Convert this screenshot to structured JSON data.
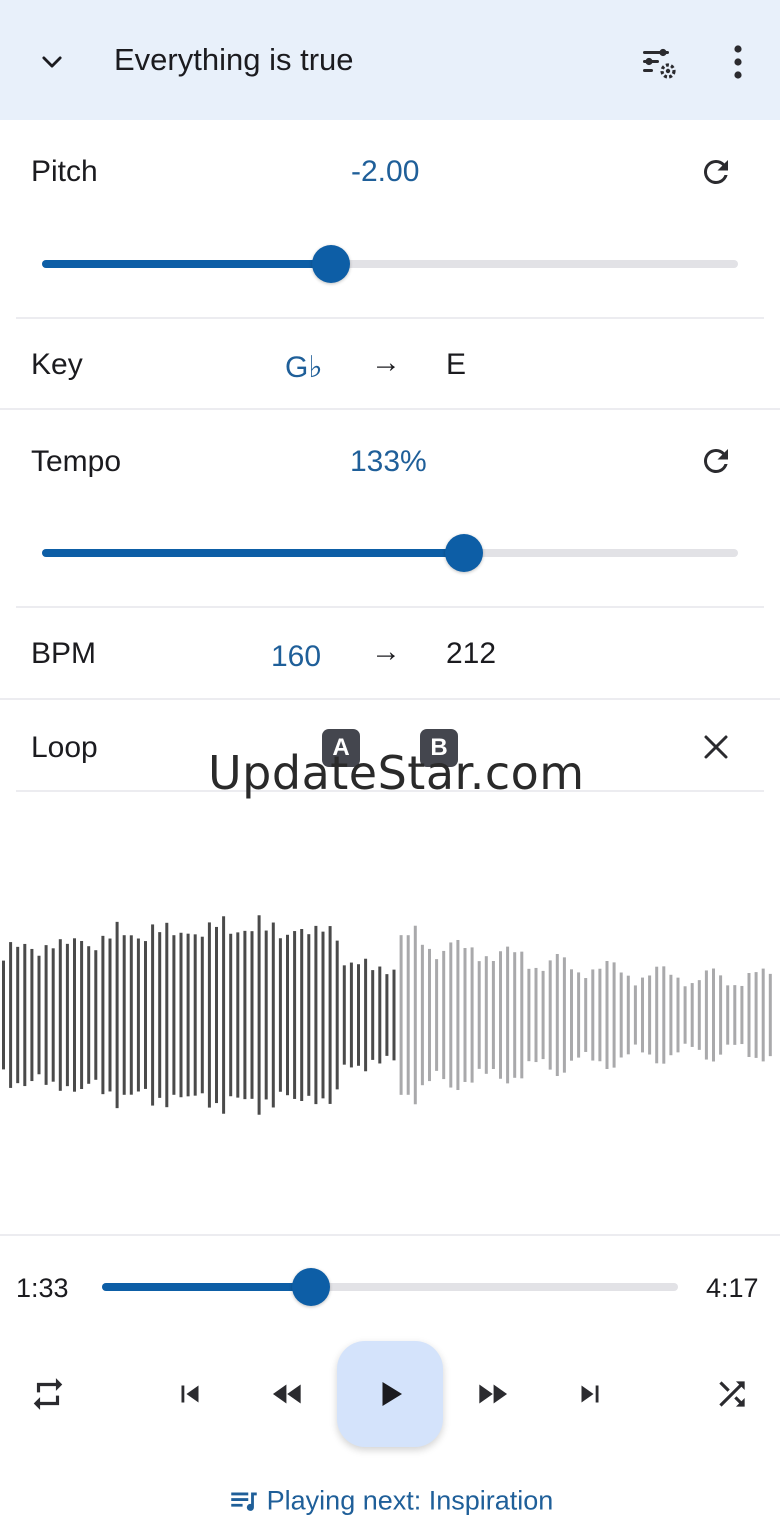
{
  "header": {
    "title": "Everything is true"
  },
  "pitch": {
    "label": "Pitch",
    "value": "-2.00",
    "slider_fraction": 0.415
  },
  "key": {
    "label": "Key",
    "from": "G♭",
    "arrow": "→",
    "to": "E"
  },
  "tempo": {
    "label": "Tempo",
    "value": "133%",
    "slider_fraction": 0.607
  },
  "bpm": {
    "label": "BPM",
    "from": "160",
    "arrow": "→",
    "to": "212"
  },
  "loop": {
    "label": "Loop",
    "a_label": "A",
    "b_label": "B"
  },
  "watermark": "UpdateStar.com",
  "playback": {
    "elapsed": "1:33",
    "total": "4:17",
    "progress_fraction": 0.362
  },
  "playing_next": {
    "text": "Playing next: Inspiration"
  },
  "colors": {
    "accent": "#0d5ea6",
    "accent_text": "#1f5f99",
    "header_bg": "#e8f0fa",
    "play_button_bg": "#d4e3fb",
    "waveform_played": "#4a4a4a",
    "waveform_unplayed": "#a9a9ab"
  },
  "icons": {
    "collapse": "chevron-down-icon",
    "equalizer_settings": "tune-settings-icon",
    "more": "more-vert-icon",
    "reset": "refresh-icon",
    "close_loop": "close-icon",
    "repeat": "repeat-icon",
    "previous": "skip-previous-icon",
    "rewind": "rewind-icon",
    "play": "play-icon",
    "fast_forward": "fast-forward-icon",
    "next": "skip-next-icon",
    "shuffle": "shuffle-icon",
    "queue": "queue-music-icon"
  }
}
